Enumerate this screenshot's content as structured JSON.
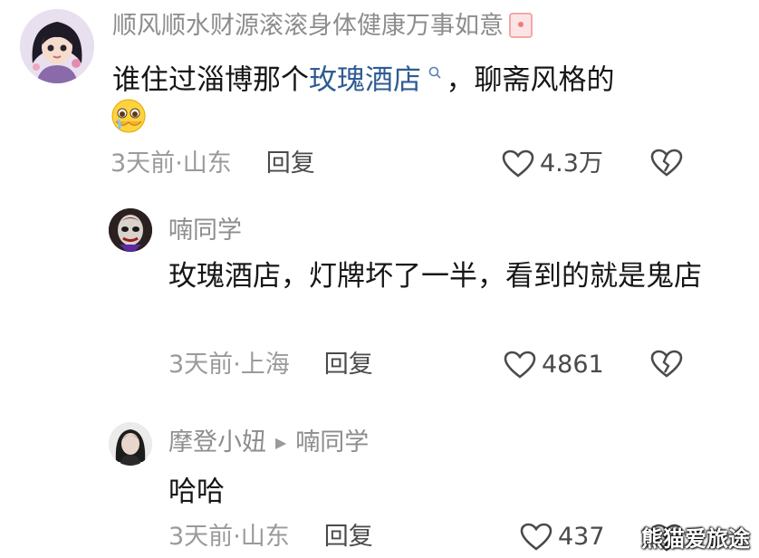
{
  "comments": [
    {
      "user": "顺风顺水财源滚滚身体健康万事如意",
      "text_prefix": "谁住过淄博那个",
      "text_link": "玫瑰酒店",
      "text_suffix": "，聊斋风格的",
      "time": "3天前",
      "location": "山东",
      "reply_label": "回复",
      "likes": "4.3万"
    },
    {
      "user": "喃同学",
      "text": "玫瑰酒店，灯牌坏了一半，看到的就是鬼店",
      "time": "3天前",
      "location": "上海",
      "reply_label": "回复",
      "likes": "4861"
    },
    {
      "user": "摩登小妞",
      "reply_to": "喃同学",
      "text": "哈哈",
      "time": "3天前",
      "location": "山东",
      "reply_label": "回复",
      "likes": "437"
    }
  ],
  "meta_separator": " · ",
  "watermark": "熊猫爱旅途",
  "colors": {
    "link": "#2f5c93",
    "muted": "#8d8d8d"
  },
  "icons": [
    "heart-outline-icon",
    "broken-heart-icon",
    "search-icon",
    "red-envelope-icon",
    "crying-emoji-icon",
    "play-triangle-icon"
  ]
}
